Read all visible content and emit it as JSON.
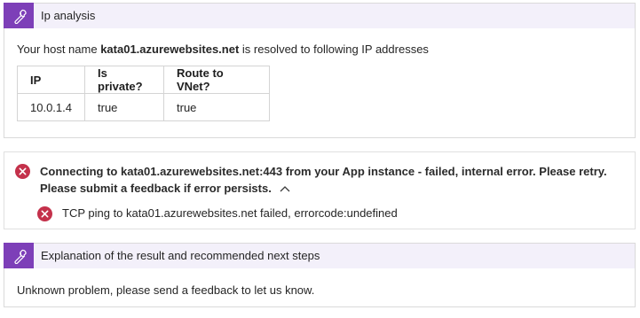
{
  "ip_analysis": {
    "title": "Ip analysis",
    "host_prefix": "Your host name ",
    "host_name": "kata01.azurewebsites.net",
    "host_suffix": " is resolved to following IP addresses",
    "table": {
      "headers": [
        "IP",
        "Is private?",
        "Route to VNet?"
      ],
      "rows": [
        [
          "10.0.1.4",
          "true",
          "true"
        ]
      ]
    }
  },
  "error": {
    "message": "Connecting to kata01.azurewebsites.net:443 from your App instance - failed, internal error. Please retry. Please submit a feedback if error persists.",
    "sub_message": "TCP ping to kata01.azurewebsites.net failed, errorcode:undefined",
    "icon": "error-circle-icon",
    "toggle_icon": "chevron-up-icon"
  },
  "explanation": {
    "title": "Explanation of the result and recommended next steps",
    "text": "Unknown problem, please send a feedback to let us know."
  },
  "colors": {
    "header_bg": "#f3f0fa",
    "badge_bg": "#7d3fb8",
    "error_red": "#c4314b",
    "border": "#dadada"
  }
}
